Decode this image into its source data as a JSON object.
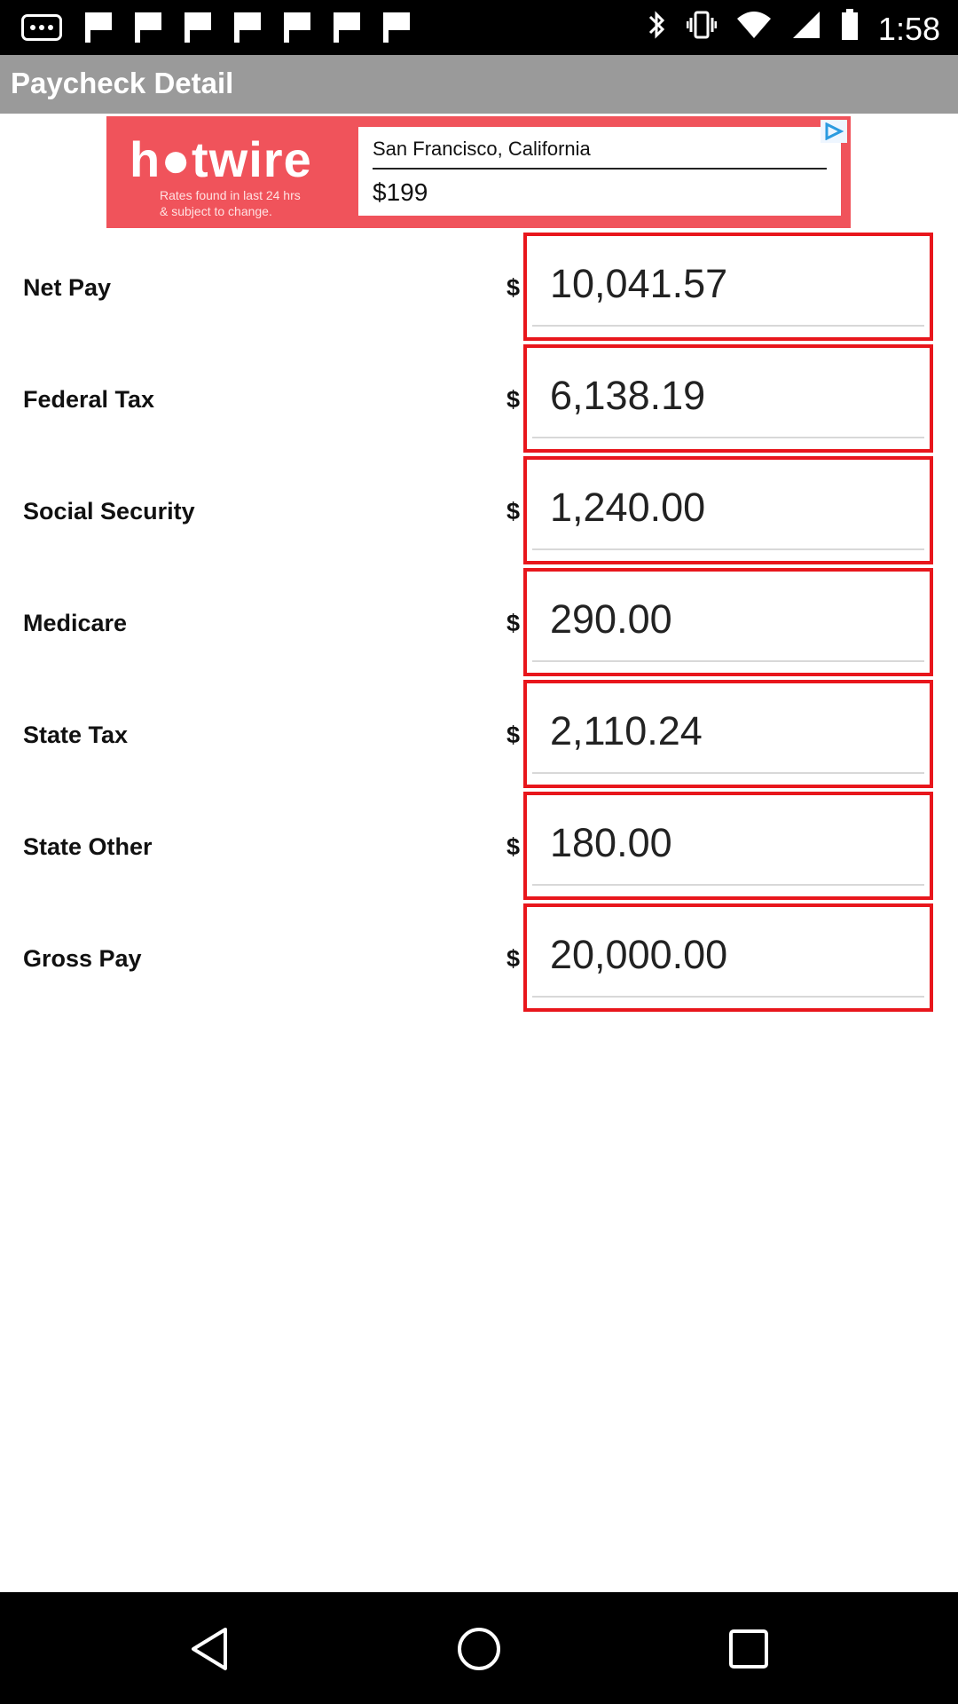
{
  "status_bar": {
    "time": "1:58",
    "icons": [
      "dots-icon",
      "flag-icon",
      "flag-icon",
      "flag-icon",
      "flag-icon",
      "flag-icon",
      "flag-icon",
      "flag-icon",
      "bluetooth-icon",
      "vibrate-icon",
      "wifi-icon",
      "signal-icon",
      "battery-icon"
    ]
  },
  "app_bar": {
    "title": "Paycheck Detail"
  },
  "ad": {
    "brand": "h●twire",
    "disclaimer": "Rates found in last 24 hrs & subject to change.",
    "city": "San Francisco, California",
    "price": "$199",
    "brand_color": "#f0535b"
  },
  "rows": [
    {
      "label": "Net Pay",
      "currency": "$",
      "value": "10,041.57"
    },
    {
      "label": "Federal Tax",
      "currency": "$",
      "value": "6,138.19"
    },
    {
      "label": "Social Security",
      "currency": "$",
      "value": "1,240.00"
    },
    {
      "label": "Medicare",
      "currency": "$",
      "value": "290.00"
    },
    {
      "label": "State Tax",
      "currency": "$",
      "value": "2,110.24"
    },
    {
      "label": "State Other",
      "currency": "$",
      "value": "180.00"
    },
    {
      "label": "Gross Pay",
      "currency": "$",
      "value": "20,000.00"
    }
  ],
  "colors": {
    "field_border": "#e8161c",
    "app_bar": "#9a9a9a"
  },
  "nav_bar": {
    "icons": [
      "back-icon",
      "home-icon",
      "recent-apps-icon"
    ]
  }
}
